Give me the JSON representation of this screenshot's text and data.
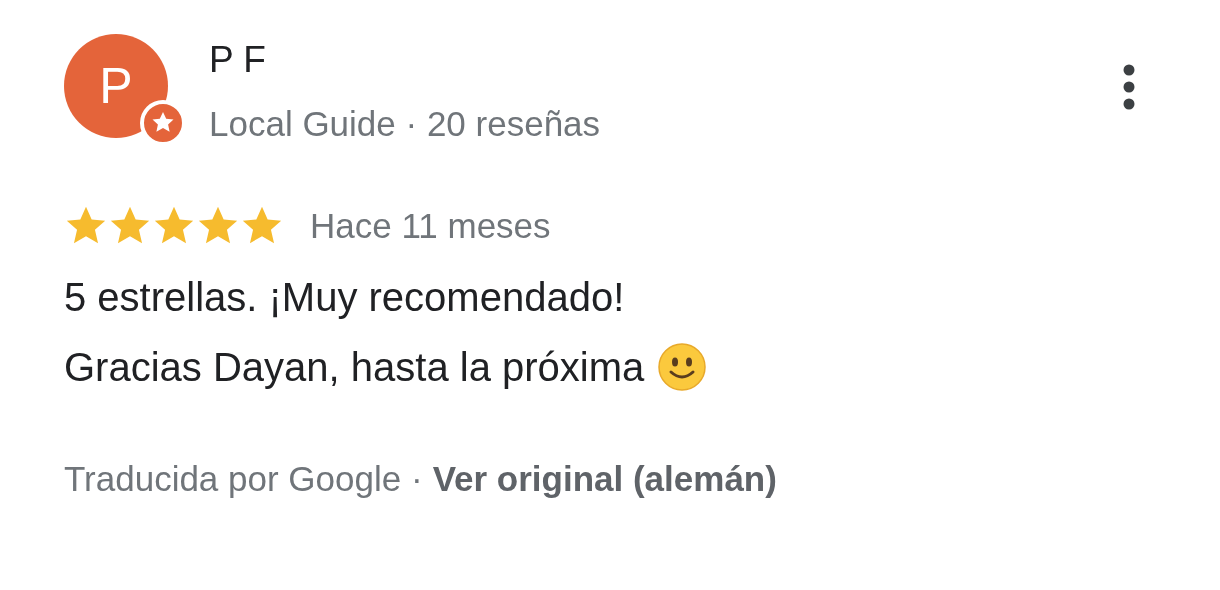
{
  "reviewer": {
    "initial": "P",
    "name": "P F",
    "local_guide_badge": true,
    "subtitle": "Local Guide · 20 reseñas"
  },
  "review": {
    "stars": 5,
    "time": "Hace 11 meses",
    "lines": [
      {
        "text": "5 estrellas. ¡Muy recomendado!"
      },
      {
        "text": "Gracias Dayan, hasta la próxima",
        "trailing_smiley": true
      }
    ],
    "translation_note": "Traducida por Google ·",
    "original_link": "Ver original (alemán)"
  }
}
